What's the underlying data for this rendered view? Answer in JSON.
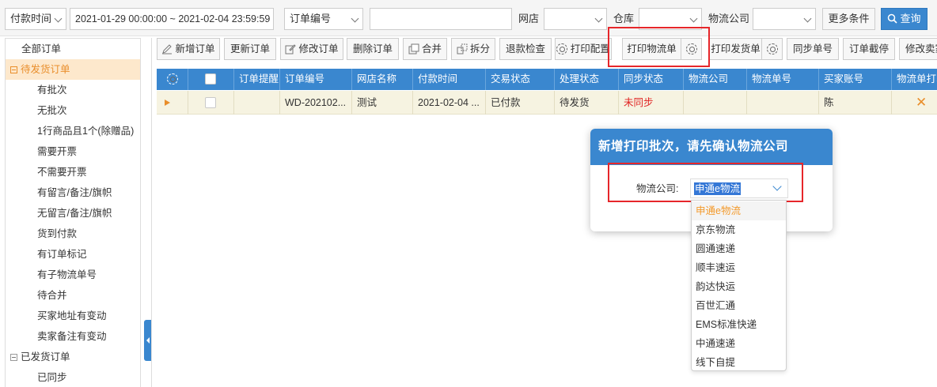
{
  "filters": {
    "date_type": "付款时间",
    "date_range": "2021-01-29 00:00:00 ~ 2021-02-04 23:59:59",
    "order_field": "订单编号",
    "order_value": "",
    "shop_label": "网店",
    "shop_value": "",
    "warehouse_label": "仓库",
    "warehouse_value": "",
    "logistics_label": "物流公司",
    "logistics_value": "",
    "more_label": "更多条件",
    "search_label": "查询"
  },
  "sidebar": {
    "items": [
      {
        "label": "全部订单",
        "level": 0
      },
      {
        "label": "待发货订单",
        "level": 0,
        "group": true,
        "selected": true
      },
      {
        "label": "有批次",
        "level": 1
      },
      {
        "label": "无批次",
        "level": 1
      },
      {
        "label": "1行商品且1个(除赠品)",
        "level": 1
      },
      {
        "label": "需要开票",
        "level": 1
      },
      {
        "label": "不需要开票",
        "level": 1
      },
      {
        "label": "有留言/备注/旗帜",
        "level": 1
      },
      {
        "label": "无留言/备注/旗帜",
        "level": 1
      },
      {
        "label": "货到付款",
        "level": 1
      },
      {
        "label": "有订单标记",
        "level": 1
      },
      {
        "label": "有子物流单号",
        "level": 1
      },
      {
        "label": "待合并",
        "level": 1
      },
      {
        "label": "买家地址有变动",
        "level": 1
      },
      {
        "label": "卖家备注有变动",
        "level": 1
      },
      {
        "label": "已发货订单",
        "level": 0,
        "group": true
      },
      {
        "label": "已同步",
        "level": 1
      }
    ]
  },
  "toolbar": {
    "new_order": "新增订单",
    "update_order": "更新订单",
    "edit_order": "修改订单",
    "delete_order": "删除订单",
    "merge": "合并",
    "split": "拆分",
    "refund_check": "退款检查",
    "print_config": "打印配置",
    "print_logistics": "打印物流单",
    "print_delivery": "打印发货单",
    "sync_tracking": "同步单号",
    "order_hold": "订单截停",
    "edit_seller": "修改卖家"
  },
  "grid": {
    "columns": [
      "订单提醒",
      "订单编号",
      "网店名称",
      "付款时间",
      "交易状态",
      "处理状态",
      "同步状态",
      "物流公司",
      "物流单号",
      "买家账号",
      "物流单打印"
    ],
    "row": {
      "reminder": "",
      "order_no": "WD-202102...",
      "shop": "测试",
      "pay_time": "2021-02-04 ...",
      "trade_status": "已付款",
      "process_status": "待发货",
      "sync_status": "未同步",
      "logistics": "",
      "tracking_no": "",
      "buyer": "陈",
      "print_mark": "✕"
    }
  },
  "dialog": {
    "title": "新增打印批次，请先确认物流公司",
    "field_label": "物流公司:",
    "selected": "申通e物流",
    "options": [
      "申通e物流",
      "京东物流",
      "圆通速递",
      "顺丰速运",
      "韵达快运",
      "百世汇通",
      "EMS标准快递",
      "中通速递",
      "线下自提"
    ]
  },
  "colors": {
    "accent": "#3a87cf",
    "sidebar_selected_bg": "#fde8cc",
    "sidebar_selected_text": "#e98e2b",
    "highlight_box": "#e6262a",
    "row_bg": "#f6f3e1",
    "status_red": "#e02020",
    "option_selected": "#f39a2c"
  },
  "icons": [
    "chevron-down-icon",
    "search-icon",
    "gear-icon",
    "pencil-icon",
    "merge-icon",
    "split-icon",
    "row-pointer-icon",
    "close-icon"
  ]
}
